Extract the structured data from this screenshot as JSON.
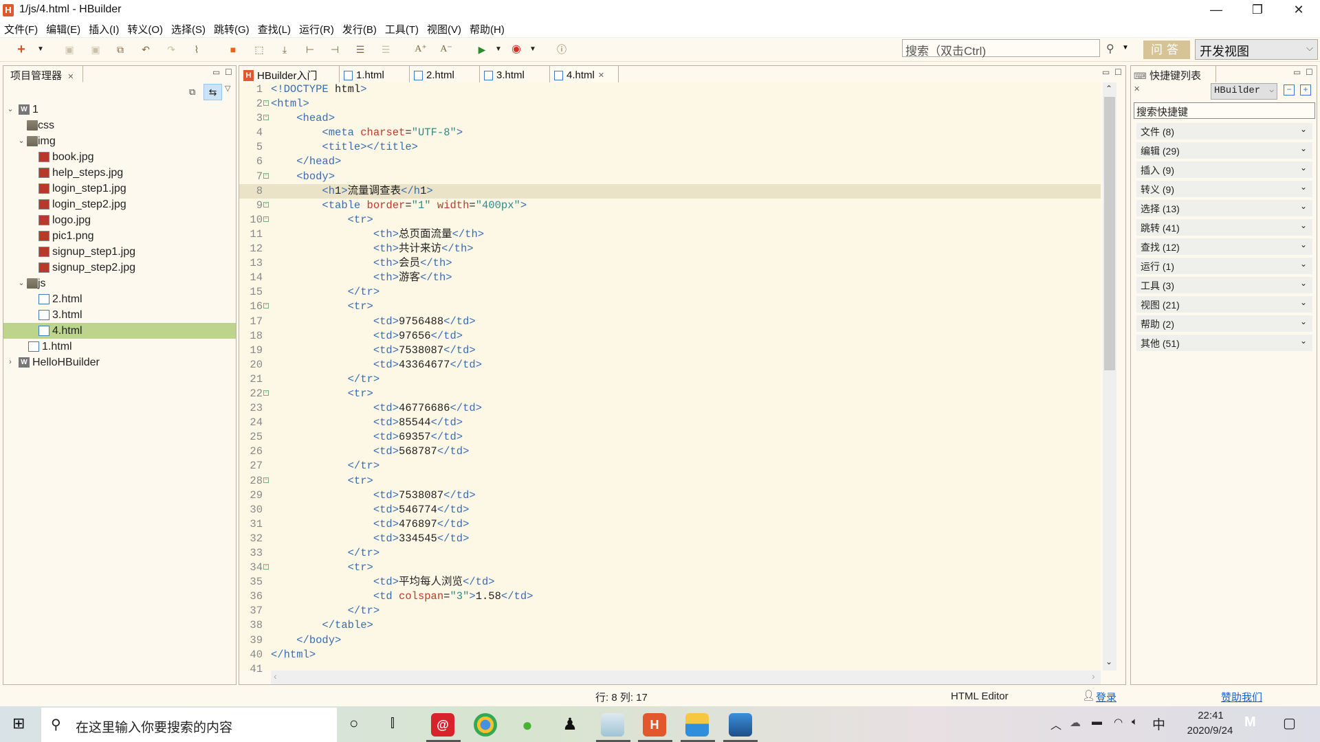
{
  "window": {
    "title": "1/js/4.html  -  HBuilder",
    "logo": "H",
    "minimize_icon": "—",
    "maximize_icon": "❐",
    "close_icon": "✕"
  },
  "menu": [
    "文件(F)",
    "编辑(E)",
    "插入(I)",
    "转义(O)",
    "选择(S)",
    "跳转(G)",
    "查找(L)",
    "运行(R)",
    "发行(B)",
    "工具(T)",
    "视图(V)",
    "帮助(H)"
  ],
  "toolbar": {
    "search_placeholder": "搜索（双击Ctrl)",
    "search_icon": "⚲",
    "wenda_label": "问答",
    "perspective": "开发视图"
  },
  "project_panel": {
    "title": "项目管理器",
    "tree": [
      {
        "label": "1",
        "type": "project",
        "depth": 0,
        "expanded": true
      },
      {
        "label": "css",
        "type": "folder",
        "depth": 1
      },
      {
        "label": "img",
        "type": "folder",
        "depth": 1,
        "expanded": true
      },
      {
        "label": "book.jpg",
        "type": "image",
        "depth": 2
      },
      {
        "label": "help_steps.jpg",
        "type": "image",
        "depth": 2
      },
      {
        "label": "login_step1.jpg",
        "type": "image",
        "depth": 2
      },
      {
        "label": "login_step2.jpg",
        "type": "image",
        "depth": 2
      },
      {
        "label": "logo.jpg",
        "type": "image",
        "depth": 2
      },
      {
        "label": "pic1.png",
        "type": "image",
        "depth": 2
      },
      {
        "label": "signup_step1.jpg",
        "type": "image",
        "depth": 2
      },
      {
        "label": "signup_step2.jpg",
        "type": "image",
        "depth": 2
      },
      {
        "label": "js",
        "type": "folder",
        "depth": 1,
        "expanded": true
      },
      {
        "label": "2.html",
        "type": "html",
        "depth": 2
      },
      {
        "label": "3.html",
        "type": "html",
        "depth": 2
      },
      {
        "label": "4.html",
        "type": "html",
        "depth": 2,
        "selected": true
      },
      {
        "label": "1.html",
        "type": "html",
        "depth": 1
      },
      {
        "label": "HelloHBuilder",
        "type": "project",
        "depth": 0,
        "expanded": false
      }
    ]
  },
  "editor": {
    "tabs": [
      {
        "label": "HBuilder入门",
        "icon": "hbuilder"
      },
      {
        "label": "1.html",
        "icon": "html"
      },
      {
        "label": "2.html",
        "icon": "html"
      },
      {
        "label": "3.html",
        "icon": "html"
      },
      {
        "label": "4.html",
        "icon": "html",
        "active": true,
        "closable": true
      }
    ],
    "current_line": 8,
    "lines": [
      "<!DOCTYPE html>",
      "<html>",
      "    <head>",
      "        <meta charset=\"UTF-8\">",
      "        <title></title>",
      "    </head>",
      "    <body>",
      "        <h1>流量调查表</h1>",
      "        <table border=\"1\" width=\"400px\">",
      "            <tr>",
      "                <th>总页面流量</th>",
      "                <th>共计来访</th>",
      "                <th>会员</th>",
      "                <th>游客</th>",
      "            </tr>",
      "            <tr>",
      "                <td>9756488</td>",
      "                <td>97656</td>",
      "                <td>7538087</td>",
      "                <td>43364677</td>",
      "            </tr>",
      "            <tr>",
      "                <td>46776686</td>",
      "                <td>85544</td>",
      "                <td>69357</td>",
      "                <td>568787</td>",
      "            </tr>",
      "            <tr>",
      "                <td>7538087</td>",
      "                <td>546774</td>",
      "                <td>476897</td>",
      "                <td>334545</td>",
      "            </tr>",
      "            <tr>",
      "                <td>平均每人浏览</td>",
      "                <td colspan=\"3\">1.58</td>",
      "            </tr>",
      "        </table>",
      "    </body>",
      "</html>",
      ""
    ],
    "fold_lines": [
      2,
      3,
      7,
      9,
      10,
      16,
      22,
      28,
      34
    ]
  },
  "shortcut_panel": {
    "title": "快捷键列表",
    "scheme": "HBuilder",
    "search_placeholder": "搜索快捷键",
    "categories": [
      "文件 (8)",
      "编辑 (29)",
      "插入 (9)",
      "转义 (9)",
      "选择 (13)",
      "跳转 (41)",
      "查找 (12)",
      "运行 (1)",
      "工具 (3)",
      "视图 (21)",
      "帮助 (2)",
      "其他 (51)"
    ]
  },
  "statusbar": {
    "position": "行: 8 列: 17",
    "editor_type": "HTML Editor",
    "login": "登录",
    "sponsor": "赞助我们"
  },
  "taskbar": {
    "search_placeholder": "在这里输入你要搜索的内容",
    "time": "22:41",
    "date": "2020/9/24",
    "ime": "中",
    "apps": [
      "netease-music",
      "chrome",
      "wechat",
      "qq",
      "notepad",
      "hbuilder",
      "file-explorer",
      "photos"
    ]
  }
}
